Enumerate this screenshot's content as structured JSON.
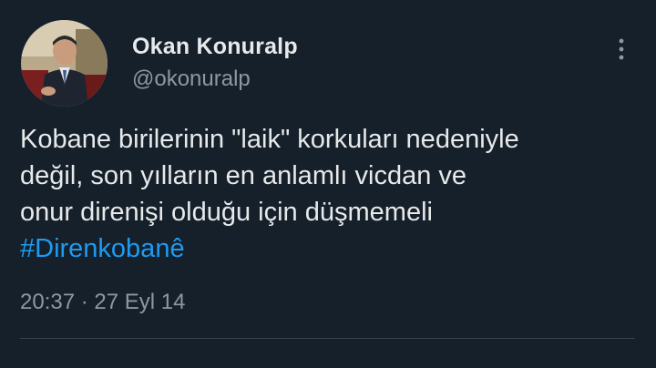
{
  "tweet": {
    "author_name": "Okan Konuralp",
    "author_handle": "@okonuralp",
    "text_lines": [
      "Kobane birilerinin \"laik\" korkuları nedeniyle",
      "değil, son yılların en anlamlı vicdan ve",
      "onur direnişi olduğu için düşmemeli"
    ],
    "hashtag": "#Direnkobanê",
    "time": "20:37",
    "separator": "·",
    "date": "27 Eyl 14"
  },
  "icons": {
    "more": "more-vertical-icon",
    "avatar": "profile-photo"
  },
  "colors": {
    "background": "#15202b",
    "text": "#e7e9ea",
    "secondary": "#8b98a5",
    "link": "#1d9bf0",
    "divider": "#38444d"
  }
}
